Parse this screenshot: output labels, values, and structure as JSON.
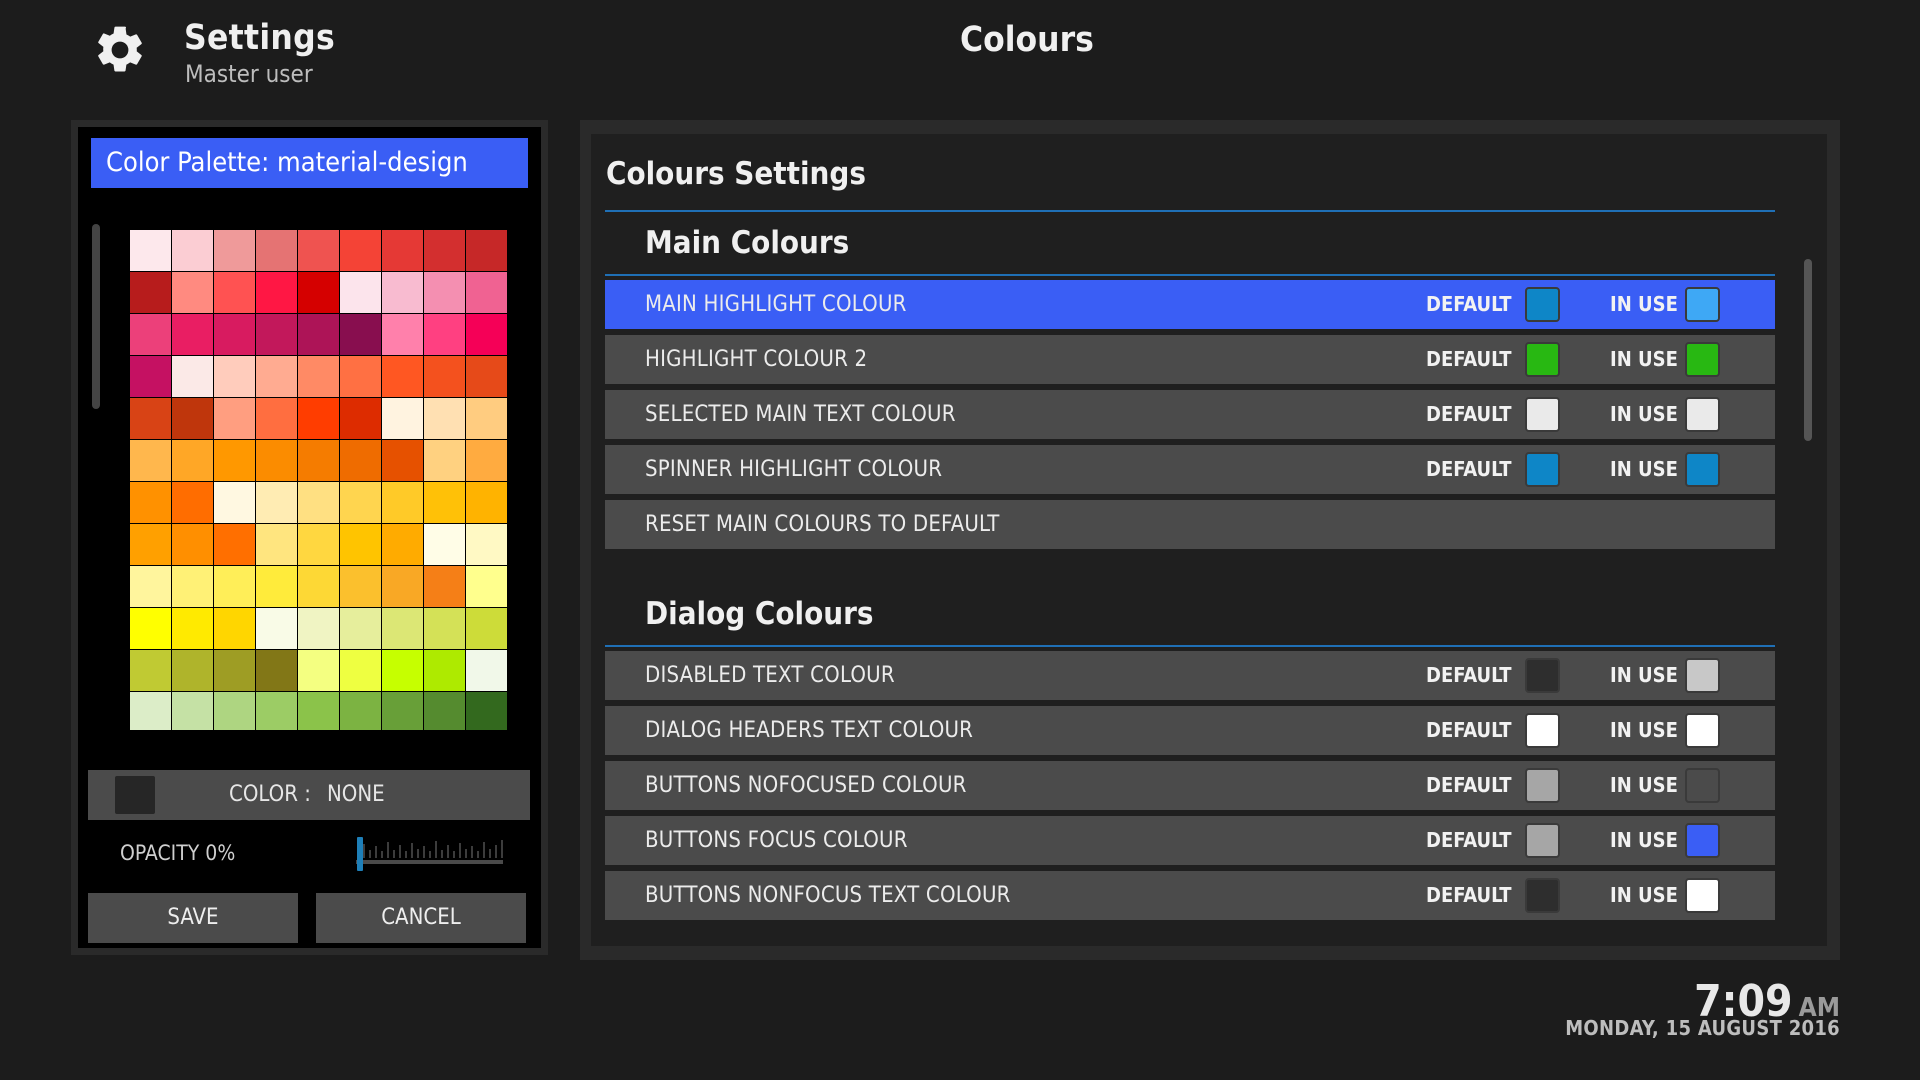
{
  "header": {
    "title": "Settings",
    "subtitle": "Master user",
    "page_heading": "Colours",
    "icon": "gear-icon"
  },
  "palette": {
    "title": "Color Palette: material-design",
    "swatches": [
      "#fde8ec",
      "#fbcdd3",
      "#ef9a9a",
      "#e57373",
      "#ef5350",
      "#f44336",
      "#e53935",
      "#d32f2f",
      "#c62828",
      "#b71c1c",
      "#ff8a80",
      "#ff5252",
      "#ff1744",
      "#d50000",
      "#fce4ec",
      "#f8bbd0",
      "#f48fb1",
      "#f06292",
      "#ec407a",
      "#e91e63",
      "#d81b60",
      "#c2185b",
      "#ad1457",
      "#880e4f",
      "#ff80ab",
      "#ff4081",
      "#f50057",
      "#c51162",
      "#fbe9e7",
      "#ffccbc",
      "#ffab91",
      "#ff8a65",
      "#ff7043",
      "#ff5722",
      "#f4511e",
      "#e64a19",
      "#d84315",
      "#bf360c",
      "#ff9e80",
      "#ff6e40",
      "#ff3d00",
      "#dd2c00",
      "#fff3e0",
      "#ffe0b2",
      "#ffcc80",
      "#ffb74d",
      "#ffa726",
      "#ff9800",
      "#fb8c00",
      "#f57c00",
      "#ef6c00",
      "#e65100",
      "#ffd180",
      "#ffab40",
      "#ff9100",
      "#ff6d00",
      "#fff8e1",
      "#ffecb3",
      "#ffe082",
      "#ffd54f",
      "#ffca28",
      "#ffc107",
      "#ffb300",
      "#ffa000",
      "#ff8f00",
      "#ff6f00",
      "#ffe57f",
      "#ffd740",
      "#ffc400",
      "#ffab00",
      "#fffde7",
      "#fff9c4",
      "#fff59d",
      "#fff176",
      "#ffee58",
      "#ffeb3b",
      "#fdd835",
      "#fbc02d",
      "#f9a825",
      "#f57f17",
      "#ffff8d",
      "#ffff00",
      "#ffea00",
      "#ffd600",
      "#f9fbe7",
      "#f0f4c3",
      "#e6ee9c",
      "#dce775",
      "#d4e157",
      "#cddc39",
      "#c0ca33",
      "#afb42b",
      "#9e9d24",
      "#827717",
      "#f4ff81",
      "#eeff41",
      "#c6ff00",
      "#aeea00",
      "#f1f8e9",
      "#dcedc8",
      "#c5e1a5",
      "#aed581",
      "#9ccc65",
      "#8bc34a",
      "#7cb342",
      "#689f38",
      "#558b2f",
      "#33691e"
    ],
    "color_label": "COLOR :",
    "color_value": "NONE",
    "opacity_label": "OPACITY 0%",
    "opacity_value": 0,
    "save_label": "SAVE",
    "cancel_label": "CANCEL"
  },
  "settings": {
    "section_title": "Colours Settings",
    "default_label": "DEFAULT",
    "inuse_label": "IN USE",
    "groups": [
      {
        "title": "Main Colours",
        "rows": [
          {
            "label": "MAIN HIGHLIGHT COLOUR",
            "default": "#0e86c7",
            "inuse": "#3ea8f5",
            "active": true
          },
          {
            "label": "HIGHLIGHT COLOUR 2",
            "default": "#28b812",
            "inuse": "#28b812"
          },
          {
            "label": "SELECTED MAIN TEXT COLOUR",
            "default": "#eaeaea",
            "inuse": "#eaeaea"
          },
          {
            "label": "SPINNER HIGHLIGHT COLOUR",
            "default": "#0e86c7",
            "inuse": "#0e86c7"
          },
          {
            "label": "RESET MAIN COLOURS TO DEFAULT"
          }
        ]
      },
      {
        "title": "Dialog Colours",
        "rows": [
          {
            "label": "DISABLED TEXT COLOUR",
            "default": "#2e2e2e",
            "inuse": "#c8c8c8"
          },
          {
            "label": "DIALOG HEADERS TEXT COLOUR",
            "default": "#ffffff",
            "inuse": "#ffffff"
          },
          {
            "label": "BUTTONS NOFOCUSED COLOUR",
            "default": "#a6a6a6",
            "inuse": "#4b4b4b"
          },
          {
            "label": "BUTTONS FOCUS COLOUR",
            "default": "#a6a6a6",
            "inuse": "#3a5ef5"
          },
          {
            "label": "BUTTONS NONFOCUS TEXT COLOUR",
            "default": "#2e2e2e",
            "inuse": "#ffffff"
          }
        ]
      }
    ]
  },
  "clock": {
    "time": "7:09",
    "ampm": "AM",
    "date": "MONDAY, 15 AUGUST 2016"
  },
  "colors": {
    "accent": "#3a5ef5",
    "divider": "#1f6fb5",
    "row_bg": "#4b4b4b",
    "bg": "#1c1c1c"
  }
}
